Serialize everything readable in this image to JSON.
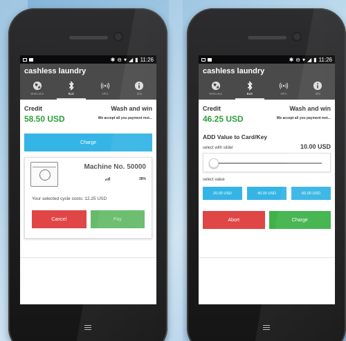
{
  "status_bar": {
    "time": "11:26"
  },
  "app_title": "cashless laundry",
  "tabs": [
    {
      "label": "Welcome",
      "icon": "globe-icon"
    },
    {
      "label": "BLE",
      "icon": "bluetooth-icon"
    },
    {
      "label": "NFC",
      "icon": "nfc-icon"
    },
    {
      "label": "Info",
      "icon": "info-icon"
    }
  ],
  "left_screen": {
    "active_tab": "BLE",
    "nfc_tab_label": "NFC",
    "credit_label": "Credit",
    "credit_value": "58.50 USD",
    "promo_title": "Wash and win",
    "promo_text": "We accept all you payment met...",
    "charge_button": "Charge",
    "machine": {
      "name": "Machine No. 50000",
      "battery": "38%",
      "cycle_cost_text": "Your selected cycle costs: 12.25 USD",
      "cancel_button": "Cancel",
      "pay_button": "Pay"
    }
  },
  "right_screen": {
    "active_tab": "BLE",
    "nfc_tab_label": "NFC",
    "credit_label": "Credit",
    "credit_value": "46.25 USD",
    "promo_title": "Wash and win",
    "promo_text": "We accept all you payment met...",
    "add_value_title": "ADD Value to Card/Key",
    "slider_label": "select with slider",
    "slider_value": "10.00 USD",
    "slider_level": 0.0,
    "select_label": "select value",
    "value_options": [
      "20.00 USD",
      "40.00 USD",
      "60.00 USD"
    ],
    "abort_button": "Abort",
    "charge_button": "Charge"
  },
  "colors": {
    "primary_blue": "#35b5e5",
    "abort_red": "#e04646",
    "charge_green": "#3fb34a",
    "credit_green": "#2e9e3a",
    "header_gray": "#4a4a4a"
  }
}
